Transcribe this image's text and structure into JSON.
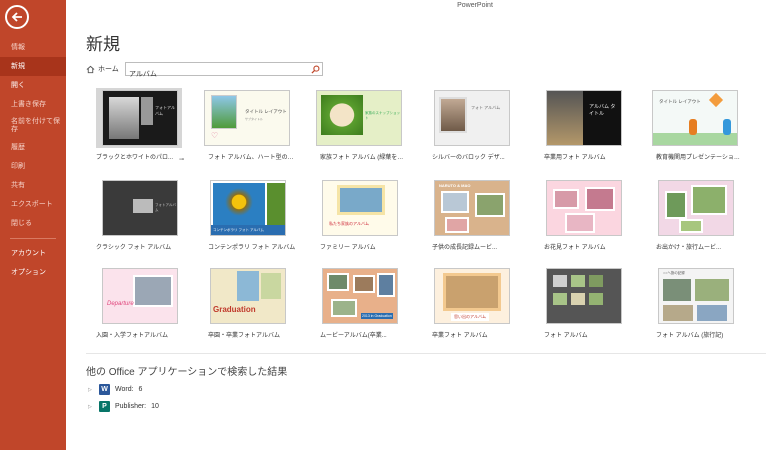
{
  "window": {
    "app_title": "PowerPoint"
  },
  "sidebar": {
    "back_label": "back",
    "items": [
      {
        "label": "情報"
      },
      {
        "label": "新規"
      },
      {
        "label": "開く"
      },
      {
        "label": "上書き保存"
      },
      {
        "label": "名前を付けて保存"
      },
      {
        "label": "履歴"
      },
      {
        "label": "印刷"
      },
      {
        "label": "共有"
      },
      {
        "label": "エクスポート"
      },
      {
        "label": "閉じる"
      },
      {
        "label": "アカウント"
      },
      {
        "label": "オプション"
      }
    ]
  },
  "page": {
    "title": "新規"
  },
  "search": {
    "home_label": "ホーム",
    "value": "アルバム"
  },
  "templates": [
    {
      "label": "ブラックとホワイトのパロ..."
    },
    {
      "label": "フォト アルバム、ハート型の花のデ..."
    },
    {
      "label": "家族フォト アルバム (緑葉をあしら..."
    },
    {
      "label": "シルバーのバロック デザ..."
    },
    {
      "label": "卒業用フォト アルバム"
    },
    {
      "label": "教育機関用プレゼンテーション、ア..."
    },
    {
      "label": "クラシック フォト アルバム"
    },
    {
      "label": "コンテンポラリ フォト アルバム"
    },
    {
      "label": "ファミリー アルバム"
    },
    {
      "label": "子供の成長記録ムービ..."
    },
    {
      "label": "お花見フォト アルバム"
    },
    {
      "label": "お出かけ・旅行ムービ..."
    },
    {
      "label": "入園・入学フォトアルバム"
    },
    {
      "label": "卒園・卒業フォトアルバム"
    },
    {
      "label": "ムービーアルバム(卒業..."
    },
    {
      "label": "卒業フォト アルバム"
    },
    {
      "label": "フォト アルバム"
    },
    {
      "label": "フォト アルバム (旅行記)"
    }
  ],
  "thumb_text": {
    "bw_title": "フォトアルバム",
    "heart_title": "タイトル レイアウト",
    "heart_sub": "サブタイトル",
    "family_title": "家族のスナップショット",
    "silver_title": "フォト アルバム",
    "grad_title": "アルバム タイトル",
    "edu_title": "タイトル レイアウト",
    "classic_title": "フォトアルバム",
    "contemporary_title": "コンテンポラリ フォト アルバム",
    "familyalbum_title": "私たち家族のアルバム",
    "growth_title": "NARUTO & MAO",
    "departure": "Departure",
    "graduation": "Graduation",
    "graduation_photo": "思い出のアルバム",
    "movie_title": "2013 in Graduation",
    "travel_title": "○○へ旅の記録"
  },
  "other_apps": {
    "title": "他の Office アプリケーションで検索した結果",
    "items": [
      {
        "name": "Word:",
        "count": "6",
        "color": "#2b579a",
        "letter": "W"
      },
      {
        "name": "Publisher:",
        "count": "10",
        "color": "#077568",
        "letter": "P"
      }
    ]
  }
}
